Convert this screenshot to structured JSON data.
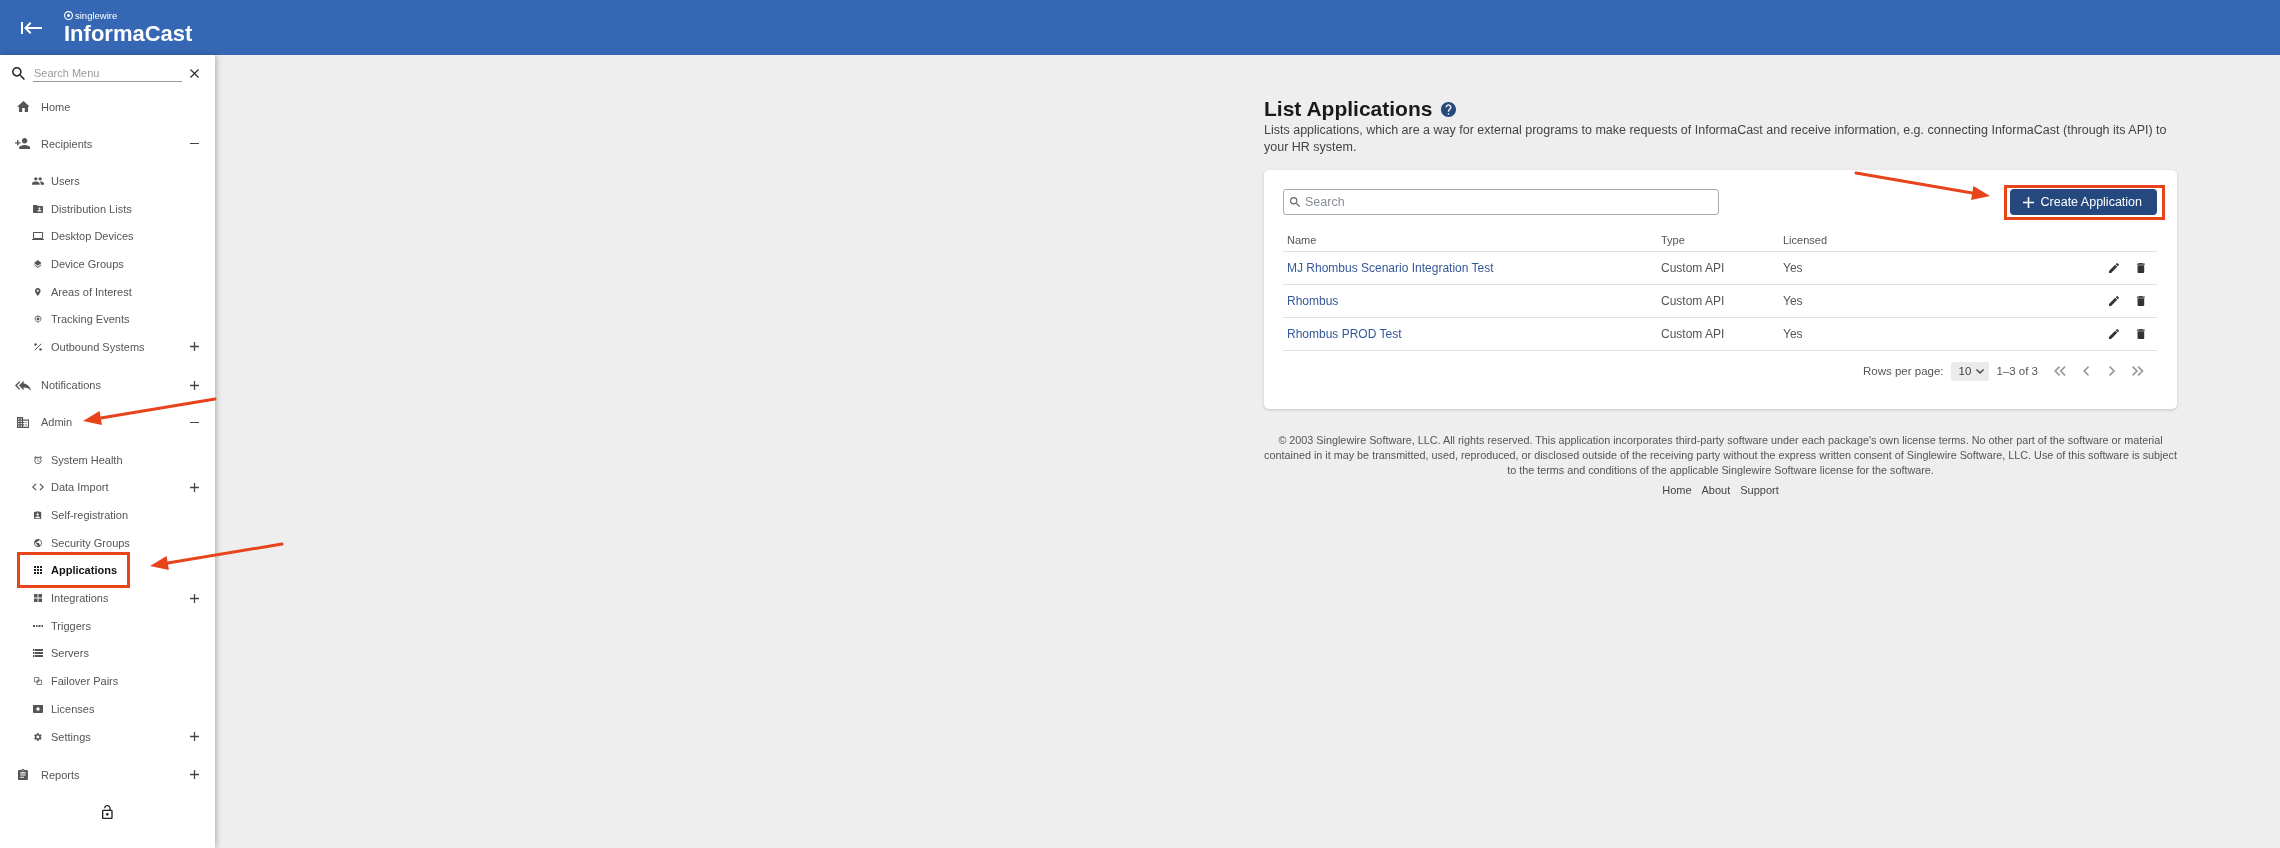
{
  "header": {
    "brand_small": "singlewire",
    "brand": "InformaCast"
  },
  "sidebar": {
    "search": {
      "placeholder": "Search Menu"
    },
    "items": [
      {
        "label": "Home",
        "kind": "link",
        "selected": false,
        "arrow": false,
        "outlined": false
      },
      {
        "label": "Recipients",
        "kind": "group",
        "expanded": true,
        "selected": false,
        "arrow": false,
        "outlined": false,
        "children": [
          {
            "label": "Users",
            "kind": "link",
            "selected": false,
            "arrow": false,
            "outlined": false
          },
          {
            "label": "Distribution Lists",
            "kind": "link",
            "selected": false,
            "arrow": false,
            "outlined": false
          },
          {
            "label": "Desktop Devices",
            "kind": "link",
            "selected": false,
            "arrow": false,
            "outlined": false
          },
          {
            "label": "Device Groups",
            "kind": "link",
            "selected": false,
            "arrow": false,
            "outlined": false
          },
          {
            "label": "Areas of Interest",
            "kind": "link",
            "selected": false,
            "arrow": false,
            "outlined": false
          },
          {
            "label": "Tracking Events",
            "kind": "link",
            "selected": false,
            "arrow": false,
            "outlined": false
          },
          {
            "label": "Outbound Systems",
            "kind": "group",
            "expanded": false,
            "selected": false,
            "arrow": false,
            "outlined": false
          }
        ]
      },
      {
        "label": "Notifications",
        "kind": "group",
        "expanded": false,
        "selected": false,
        "arrow": false,
        "outlined": false
      },
      {
        "label": "Admin",
        "kind": "group",
        "expanded": true,
        "selected": false,
        "arrow": true,
        "outlined": false,
        "children": [
          {
            "label": "System Health",
            "kind": "link",
            "selected": false,
            "arrow": false,
            "outlined": false
          },
          {
            "label": "Data Import",
            "kind": "group",
            "expanded": false,
            "selected": false,
            "arrow": false,
            "outlined": false
          },
          {
            "label": "Self-registration",
            "kind": "link",
            "selected": false,
            "arrow": false,
            "outlined": false
          },
          {
            "label": "Security Groups",
            "kind": "link",
            "selected": false,
            "arrow": false,
            "outlined": false
          },
          {
            "label": "Applications",
            "kind": "link",
            "selected": true,
            "arrow": true,
            "outlined": true
          },
          {
            "label": "Integrations",
            "kind": "group",
            "expanded": false,
            "selected": false,
            "arrow": false,
            "outlined": false
          },
          {
            "label": "Triggers",
            "kind": "link",
            "selected": false,
            "arrow": false,
            "outlined": false
          },
          {
            "label": "Servers",
            "kind": "link",
            "selected": false,
            "arrow": false,
            "outlined": false
          },
          {
            "label": "Failover Pairs",
            "kind": "link",
            "selected": false,
            "arrow": false,
            "outlined": false
          },
          {
            "label": "Licenses",
            "kind": "link",
            "selected": false,
            "arrow": false,
            "outlined": false
          },
          {
            "label": "Settings",
            "kind": "group",
            "expanded": false,
            "selected": false,
            "arrow": false,
            "outlined": false
          }
        ]
      },
      {
        "label": "Reports",
        "kind": "group",
        "expanded": false,
        "selected": false,
        "arrow": false,
        "outlined": false
      }
    ]
  },
  "page": {
    "title": "List Applications",
    "description": "Lists applications, which are a way for external programs to make requests of InformaCast and receive information, e.g. connecting InformaCast (through its API) to your HR system."
  },
  "toolbar": {
    "search": {
      "placeholder": "Search"
    },
    "create_button": {
      "label": "Create Application",
      "arrow": true,
      "outlined": true
    }
  },
  "table": {
    "columns": [
      "Name",
      "Type",
      "Licensed"
    ],
    "rows": [
      {
        "name": "MJ Rhombus Scenario Integration Test",
        "type": "Custom API",
        "licensed": "Yes"
      },
      {
        "name": "Rhombus",
        "type": "Custom API",
        "licensed": "Yes"
      },
      {
        "name": "Rhombus PROD Test",
        "type": "Custom API",
        "licensed": "Yes"
      }
    ]
  },
  "pagination": {
    "rows_per_page_label": "Rows per page:",
    "rows_per_page": "10",
    "range": "1–3 of 3",
    "buttons": [
      {
        "disabled": true
      },
      {
        "disabled": true
      },
      {
        "disabled": true
      },
      {
        "disabled": true
      }
    ]
  },
  "footer": {
    "copyright": "© 2003 Singlewire Software, LLC. All rights reserved. This application incorporates third-party software under each package's own license terms. No other part of the software or material contained in it may be transmitted, used, reproduced, or disclosed outside of the receiving party without the express written consent of Singlewire Software, LLC. Use of this software is subject to the terms and conditions of the applicable Singlewire Software license for the software.",
    "links": [
      "Home",
      "About",
      "Support"
    ]
  }
}
